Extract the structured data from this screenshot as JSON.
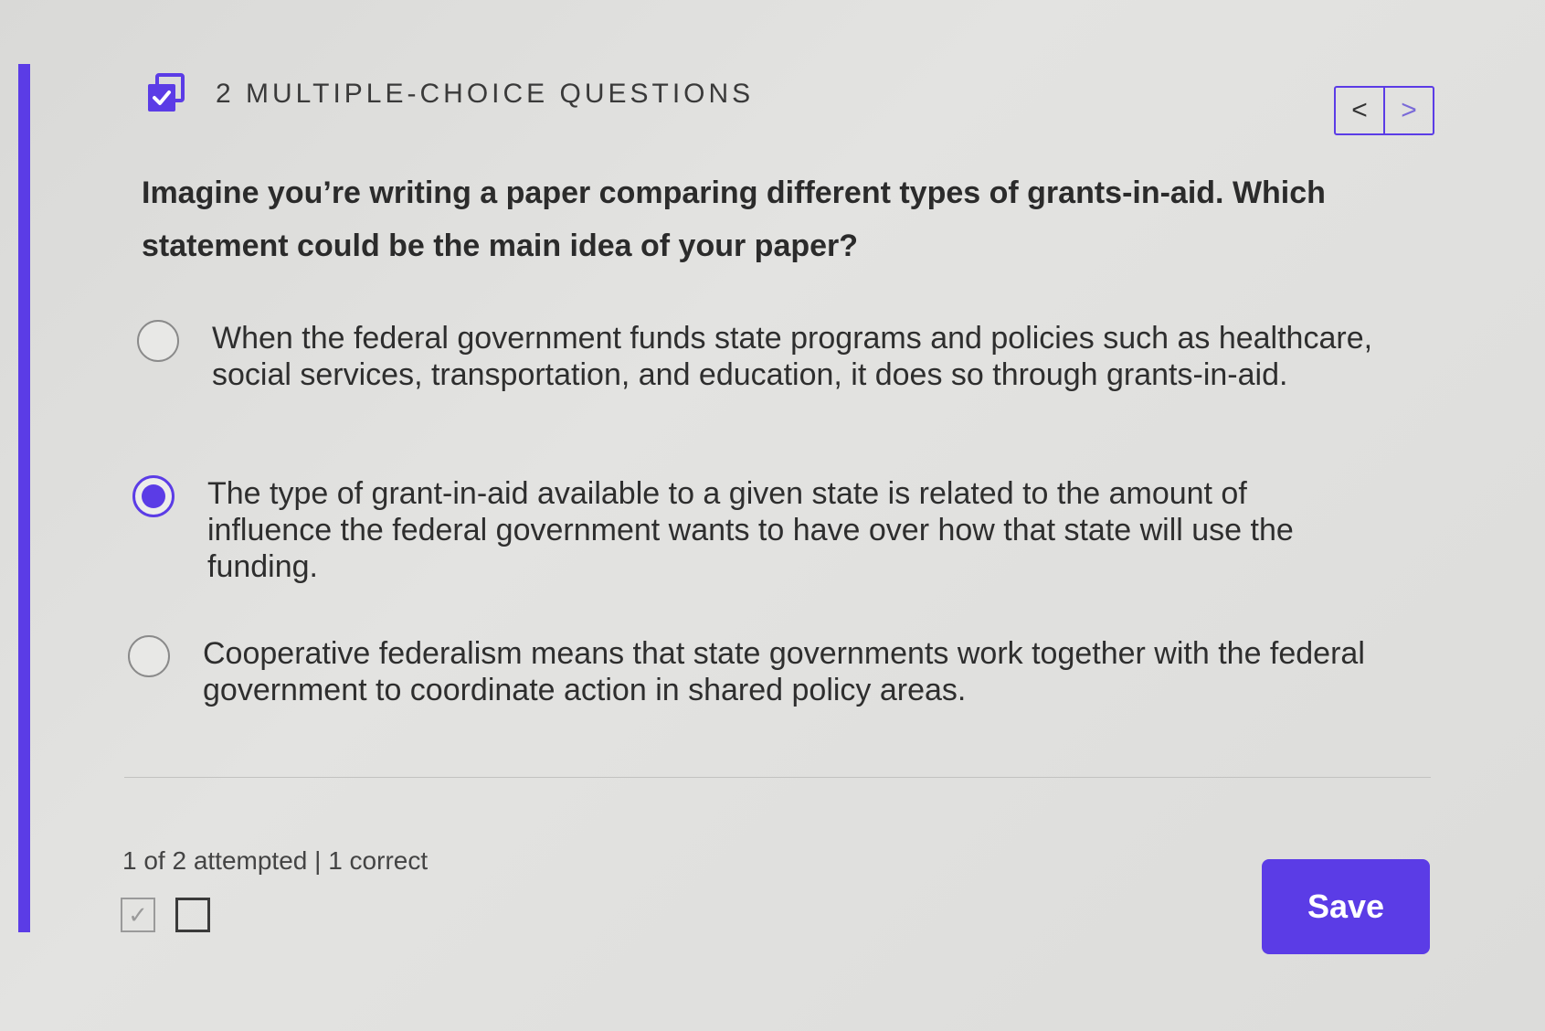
{
  "header": {
    "title": "2 MULTIPLE-CHOICE QUESTIONS",
    "icon": "checkbox-stack-icon",
    "prev_icon": "chevron-left-icon",
    "next_icon": "chevron-right-icon",
    "prev_glyph": "<",
    "next_glyph": ">"
  },
  "question": {
    "text": "Imagine you’re writing a paper comparing different types of grants-in-aid. Which statement could be the main idea of your paper?"
  },
  "options": [
    {
      "text": "When the federal government funds state programs and policies such as healthcare, social services, transportation, and education, it does so through grants-in-aid.",
      "selected": false
    },
    {
      "text": "The type of grant-in-aid available to a given state is related to the amount of influence the federal government wants to have over how that state will use the funding.",
      "selected": true
    },
    {
      "text": "Cooperative federalism means that state governments work together with the federal government to coordinate action in shared policy areas.",
      "selected": false
    }
  ],
  "footer": {
    "status": "1 of 2 attempted | 1 correct",
    "progress": [
      {
        "state": "correct",
        "glyph": "✓"
      },
      {
        "state": "unanswered",
        "glyph": ""
      }
    ],
    "save_label": "Save"
  },
  "colors": {
    "accent": "#5b3ce6",
    "background": "#dededc",
    "text": "#2e2e2e"
  }
}
